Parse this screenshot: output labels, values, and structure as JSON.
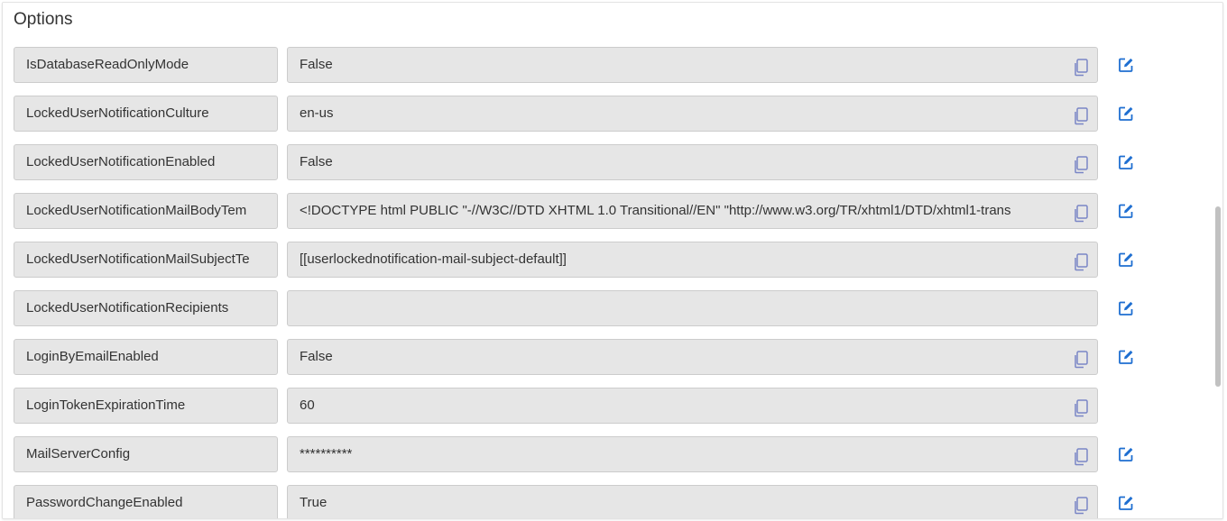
{
  "panel": {
    "title": "Options"
  },
  "colors": {
    "field_bg": "#e6e6e6",
    "field_border": "#cccccc",
    "copy_icon": "#7a86c6",
    "edit_icon": "#1f6fd1",
    "text": "#333333"
  },
  "options": [
    {
      "name": "IsDatabaseReadOnlyMode",
      "value": "False",
      "copy": true,
      "edit": true
    },
    {
      "name": "LockedUserNotificationCulture",
      "value": "en-us",
      "copy": true,
      "edit": true
    },
    {
      "name": "LockedUserNotificationEnabled",
      "value": "False",
      "copy": true,
      "edit": true
    },
    {
      "name": "LockedUserNotificationMailBodyTem",
      "value": "<!DOCTYPE html PUBLIC \"-//W3C//DTD XHTML 1.0 Transitional//EN\" \"http://www.w3.org/TR/xhtml1/DTD/xhtml1-trans",
      "copy": true,
      "edit": true
    },
    {
      "name": "LockedUserNotificationMailSubjectTe",
      "value": "[[userlockednotification-mail-subject-default]]",
      "copy": true,
      "edit": true
    },
    {
      "name": "LockedUserNotificationRecipients",
      "value": "",
      "copy": false,
      "edit": true
    },
    {
      "name": "LoginByEmailEnabled",
      "value": "False",
      "copy": true,
      "edit": true
    },
    {
      "name": "LoginTokenExpirationTime",
      "value": "60",
      "copy": true,
      "edit": false
    },
    {
      "name": "MailServerConfig",
      "value": "**********",
      "copy": true,
      "edit": true
    },
    {
      "name": "PasswordChangeEnabled",
      "value": "True",
      "copy": true,
      "edit": true
    }
  ],
  "icons": {
    "copy": "copy-icon",
    "edit": "edit-icon"
  }
}
